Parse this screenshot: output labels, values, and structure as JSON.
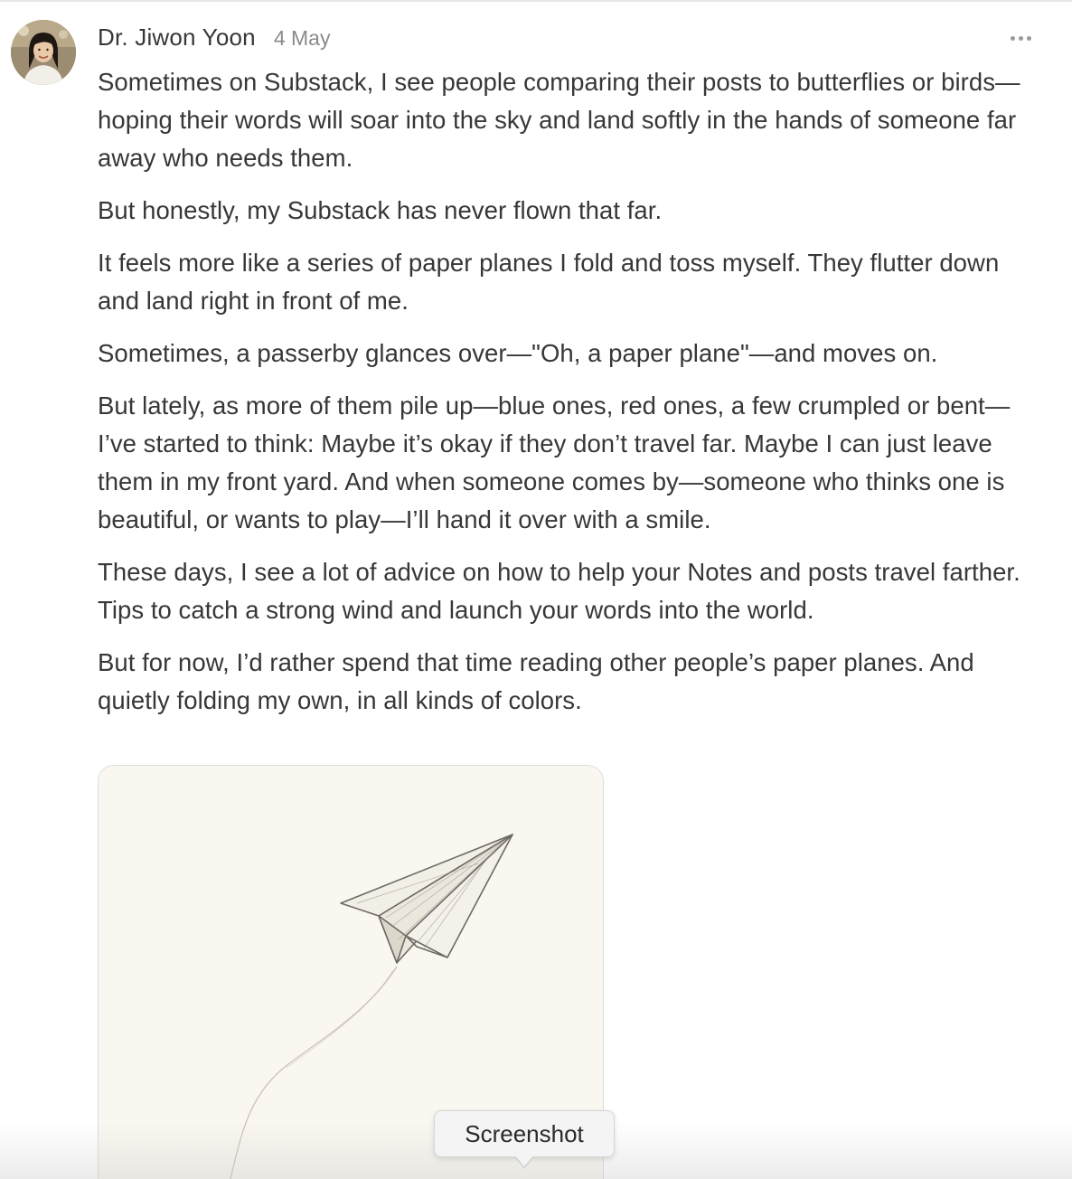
{
  "note": {
    "author": "Dr. Jiwon Yoon",
    "date": "4 May",
    "more_icon": "more-horizontal-icon",
    "paragraphs": [
      "Sometimes on Substack, I see people comparing their posts to butterflies or birds—hoping their words will soar into the sky and land softly in the hands of someone far away who needs them.",
      "But honestly, my Substack has never flown that far.",
      "It feels more like a series of paper planes I fold and toss myself. They flutter down and land right in front of me.",
      "Sometimes, a passerby glances over—\"Oh, a paper plane\"—and moves on.",
      "But lately, as more of them pile up—blue ones, red ones, a few crumpled or bent—I’ve started to think: Maybe it’s okay if they don’t travel far. Maybe I can just leave them in my front yard. And when someone comes by—someone who thinks one is beautiful, or wants to play—I’ll hand it over with a smile.",
      "These days, I see a lot of advice on how to help your Notes and posts travel farther. Tips to catch a strong wind and launch your words into the world.",
      "But for now, I’d rather spend that time reading other people’s paper planes. And quietly folding my own, in all kinds of colors."
    ]
  },
  "tooltip": {
    "label": "Screenshot"
  },
  "colors": {
    "text": "#363737",
    "muted": "#8a8a8a",
    "image_bg": "#faf7f0"
  }
}
